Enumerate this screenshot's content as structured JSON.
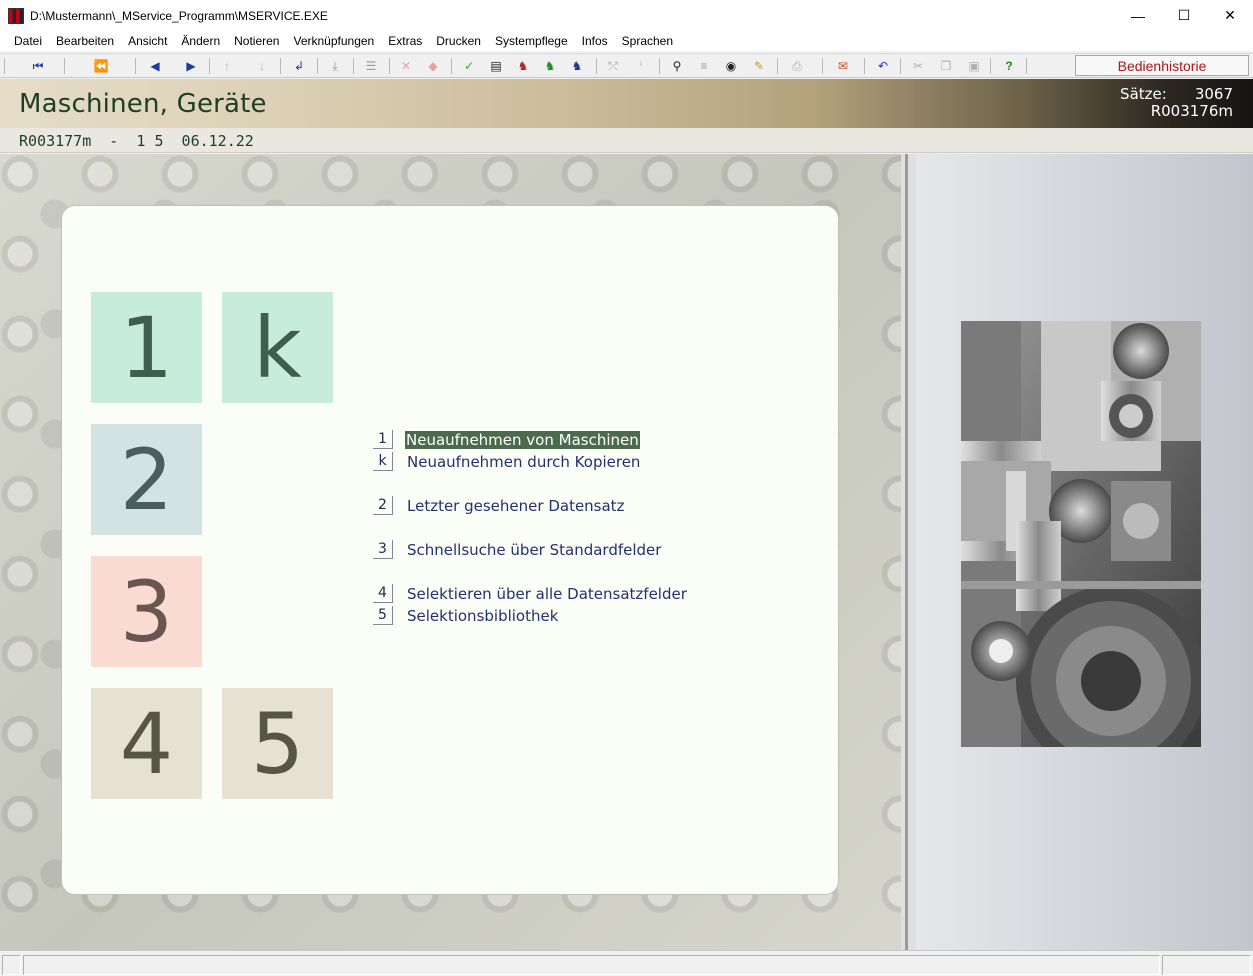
{
  "window": {
    "title": "D:\\Mustermann\\_MService_Programm\\MSERVICE.EXE",
    "minimize_glyph": "—",
    "maximize_glyph": "☐",
    "close_glyph": "✕"
  },
  "menu": [
    "Datei",
    "Bearbeiten",
    "Ansicht",
    "Ändern",
    "Notieren",
    "Verknüpfungen",
    "Extras",
    "Drucken",
    "Systempflege",
    "Infos",
    "Sprachen"
  ],
  "toolbar": {
    "history_label": "Bedienhistorie",
    "icons": {
      "first": "⏮",
      "prev_page": "⏪",
      "prev": "◀",
      "next": "▶",
      "up": "↑",
      "down": "↓",
      "enter": "↲",
      "export": "⤓",
      "tree": "☰",
      "delete": "✕",
      "erase": "◆",
      "check": "✓",
      "document": "▤",
      "red_tool": "♞",
      "green_tool": "♞",
      "blue_tool": "♞",
      "share": "⤲",
      "info": "ⁱ",
      "binoculars": "⚲",
      "list": "≡",
      "eye": "◉",
      "brush": "✎",
      "print": "⎙",
      "mail": "✉",
      "undo": "↶",
      "cut": "✂",
      "copy": "❐",
      "paste": "▣",
      "help": "?"
    }
  },
  "header": {
    "title": "Maschinen, Geräte",
    "count_label": "Sätze:",
    "count_value": "3067",
    "record_id": "R003176m"
  },
  "record_line": "R003177m  -  1 5  06.12.22",
  "tiles": [
    {
      "key": "1"
    },
    {
      "key": "k"
    },
    {
      "key": "2"
    },
    {
      "key": "3"
    },
    {
      "key": "4"
    },
    {
      "key": "5"
    }
  ],
  "options": [
    {
      "key": "1",
      "label": "Neuaufnehmen von Maschinen"
    },
    {
      "key": "k",
      "label": "Neuaufnehmen durch Kopieren"
    },
    {
      "key": "2",
      "label": "Letzter gesehener Datensatz"
    },
    {
      "key": "3",
      "label": "Schnellsuche über Standardfelder"
    },
    {
      "key": "4",
      "label": "Selektieren über alle Datensatzfelder"
    },
    {
      "key": "5",
      "label": "Selektionsbibliothek"
    }
  ],
  "colors": {
    "tile_green": "#c8ecdc",
    "tile_blue": "#d3e3e4",
    "tile_red": "#f9dbd2",
    "tile_beige": "#e6e2d2",
    "selected_bg": "#4d6a4f",
    "history_text": "#b01515"
  }
}
